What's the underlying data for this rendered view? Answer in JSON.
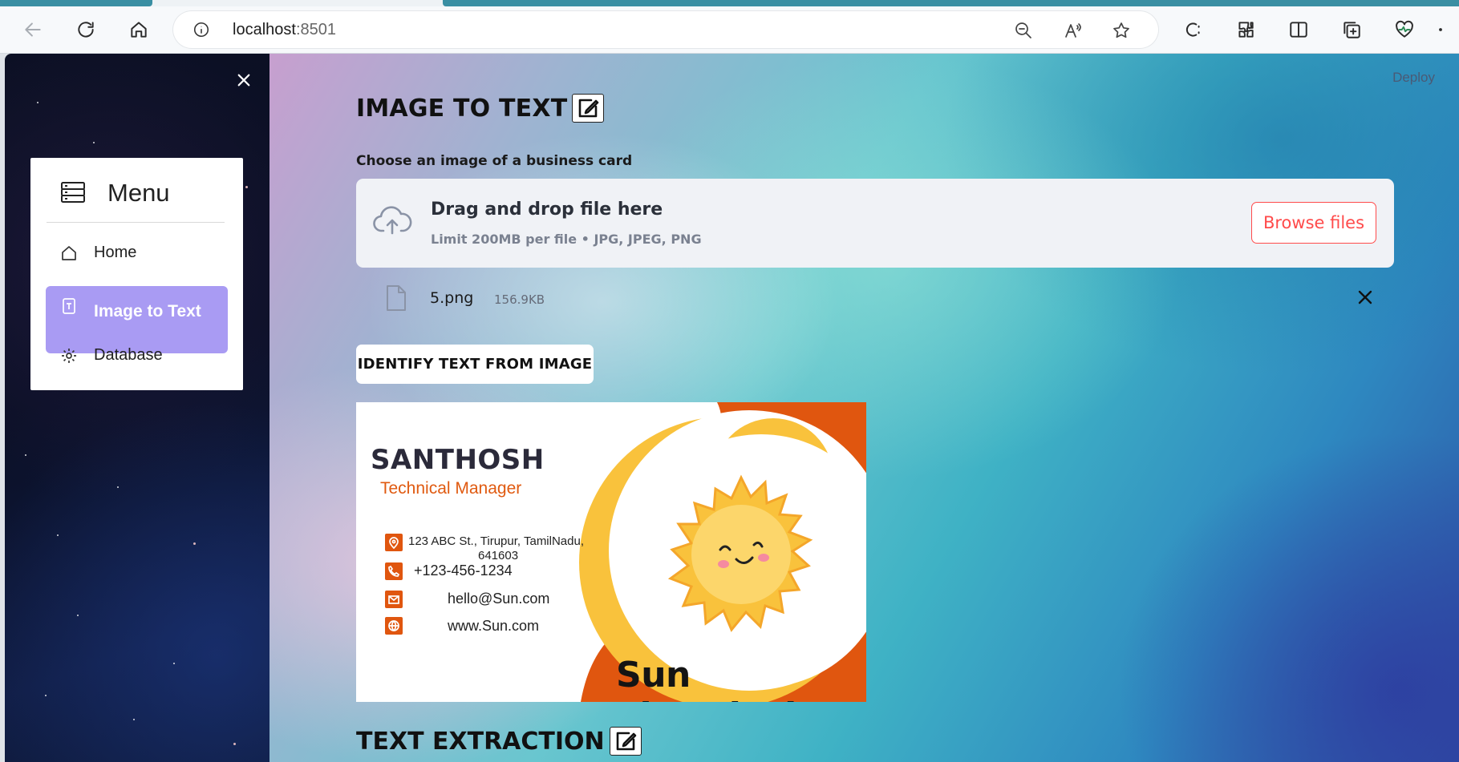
{
  "browser": {
    "url_host": "localhost",
    "url_port": ":8501"
  },
  "sidebar": {
    "menu_title": "Menu",
    "items": [
      {
        "label": "Home",
        "icon": "house-icon"
      },
      {
        "label": "Image to Text",
        "icon": "file-text-icon",
        "active": true
      },
      {
        "label": "Database",
        "icon": "gear-icon"
      }
    ],
    "active_color": "#a99bf3"
  },
  "header": {
    "deploy_label": "Deploy"
  },
  "main": {
    "title": "IMAGE TO TEXT",
    "uploader": {
      "label": "Choose an image of a business card",
      "drop_title": "Drag and drop file here",
      "drop_hint": "Limit 200MB per file • JPG, JPEG, PNG",
      "browse_label": "Browse files"
    },
    "uploaded_file": {
      "name": "5.png",
      "size": "156.9KB"
    },
    "identify_label": "IDENTIFY TEXT FROM IMAGE",
    "card": {
      "name": "SANTHOSH",
      "role": "Technical Manager",
      "address_line1": "123 ABC St., Tirupur, TamilNadu,",
      "address_line2": "641603",
      "phone": "+123-456-1234",
      "email": "hello@Sun.com",
      "website": "www.Sun.com",
      "company": "Sun Electricals",
      "accent_color": "#e0560f",
      "sun_color": "#f9c23c"
    },
    "section2_title": "TEXT EXTRACTION"
  },
  "colors": {
    "primary": "#ff4b4b"
  }
}
